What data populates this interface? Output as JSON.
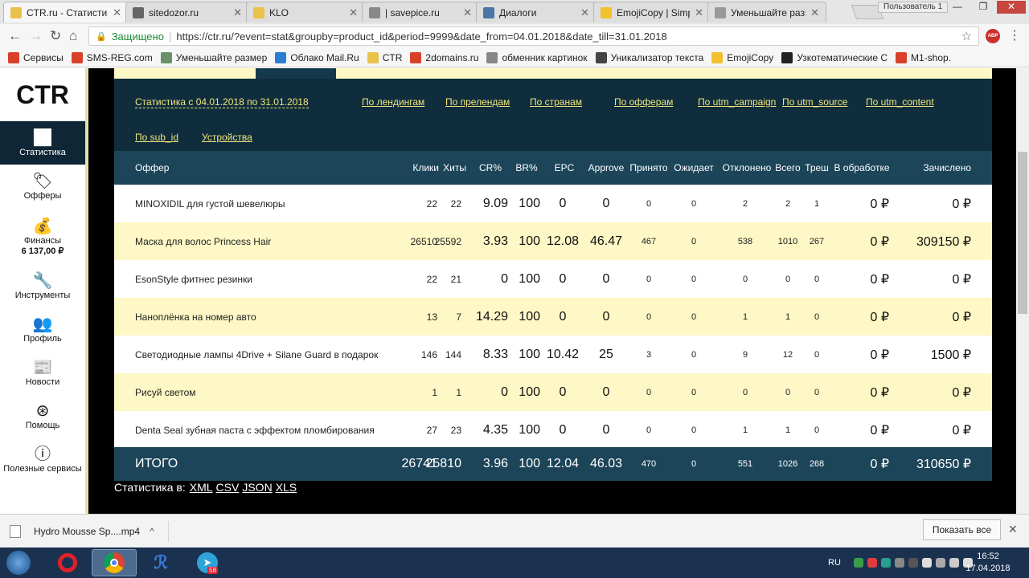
{
  "browser": {
    "tabs": [
      {
        "title": "CTR.ru - Статистика",
        "active": true,
        "icon": "folder-icon",
        "color": "#e8c24a"
      },
      {
        "title": "sitedozor.ru",
        "icon": "globe-icon",
        "color": "#666666"
      },
      {
        "title": "KLO",
        "icon": "mail-icon",
        "color": "#e8c24a"
      },
      {
        "title": "| savepice.ru",
        "icon": "page-icon",
        "color": "#888888"
      },
      {
        "title": "Диалоги",
        "icon": "vk-icon",
        "color": "#4a76a8"
      },
      {
        "title": "EmojiCopy | Simple",
        "icon": "emoji-icon",
        "color": "#f2c12e"
      },
      {
        "title": "Уменьшайте разме",
        "icon": "loading-icon",
        "color": "#999999"
      }
    ],
    "user": "Пользователь 1",
    "secure_label": "Защищено",
    "url": "https://ctr.ru/?event=stat&groupby=product_id&period=9999&date_from=04.01.2018&date_till=31.01.2018",
    "abp": "ABP",
    "bookmarks": [
      {
        "label": "Сервисы",
        "icon": "apps-icon",
        "color": "#d9402b"
      },
      {
        "label": "SMS-REG.com",
        "icon": "sms-icon",
        "color": "#d9402b"
      },
      {
        "label": "Уменьшайте размер",
        "icon": "compress-icon",
        "color": "#6a8f6a"
      },
      {
        "label": "Облако Mail.Ru",
        "icon": "cloud-icon",
        "color": "#2a7fd4"
      },
      {
        "label": "CTR",
        "icon": "folder-icon",
        "color": "#e8c24a"
      },
      {
        "label": "2domains.ru",
        "icon": "domains-icon",
        "color": "#d9402b"
      },
      {
        "label": "обменник картинок",
        "icon": "page-icon",
        "color": "#888888"
      },
      {
        "label": "Уникализатор текста",
        "icon": "copyright-icon",
        "color": "#444444"
      },
      {
        "label": "EmojiCopy",
        "icon": "emoji-icon",
        "color": "#f2c12e"
      },
      {
        "label": "Узкотематические С",
        "icon": "seo-icon",
        "color": "#222222"
      },
      {
        "label": "M1-shop.",
        "icon": "m1-icon",
        "color": "#d9402b"
      }
    ]
  },
  "sidebar": {
    "logo": "CTR",
    "items": [
      {
        "label": "Статистика",
        "icon": "chart-icon",
        "active": true
      },
      {
        "label": "Офферы",
        "icon": "tag-icon"
      },
      {
        "label": "Финансы",
        "icon": "money-bag-icon",
        "balance": "6 137,00 ₽"
      },
      {
        "label": "Инструменты",
        "icon": "wrench-icon"
      },
      {
        "label": "Профиль",
        "icon": "users-icon"
      },
      {
        "label": "Новости",
        "icon": "news-icon",
        "badge": "NEWS"
      },
      {
        "label": "Помощь",
        "icon": "help-icon"
      },
      {
        "label": "Полезные сервисы",
        "icon": "info-icon"
      }
    ]
  },
  "stats_nav": {
    "period_link": "Статистика с 04.01.2018 по 31.01.2018",
    "links": [
      "По лендингам",
      "По прелендам",
      "По странам",
      "По офферам",
      "По utm_campaign",
      "По utm_source",
      "По utm_content",
      "По sub_id",
      "Устройства"
    ]
  },
  "table": {
    "headers": [
      "Оффер",
      "Клики",
      "Хиты",
      "CR%",
      "BR%",
      "EPC",
      "Approve",
      "Принято",
      "Ожидает",
      "Отклонено",
      "Всего",
      "Треш",
      "В обработке",
      "Зачислено"
    ],
    "rows": [
      {
        "offer": "MINOXIDIL для густой шевелюры",
        "clicks": "22",
        "hits": "22",
        "cr": "9.09",
        "br": "100",
        "epc": "0",
        "approve": "0",
        "accepted": "0",
        "pending": "0",
        "rejected": "2",
        "total": "2",
        "trash": "1",
        "processing": "0 ₽",
        "credited": "0 ₽"
      },
      {
        "offer": "Маска для волос Princess Hair",
        "clicks": "26510",
        "hits": "25592",
        "cr": "3.93",
        "br": "100",
        "epc": "12.08",
        "approve": "46.47",
        "accepted": "467",
        "pending": "0",
        "rejected": "538",
        "total": "1010",
        "trash": "267",
        "processing": "0 ₽",
        "credited": "309150 ₽"
      },
      {
        "offer": "EsonStyle фитнес резинки",
        "clicks": "22",
        "hits": "21",
        "cr": "0",
        "br": "100",
        "epc": "0",
        "approve": "0",
        "accepted": "0",
        "pending": "0",
        "rejected": "0",
        "total": "0",
        "trash": "0",
        "processing": "0 ₽",
        "credited": "0 ₽"
      },
      {
        "offer": "Наноплёнка на номер авто",
        "clicks": "13",
        "hits": "7",
        "cr": "14.29",
        "br": "100",
        "epc": "0",
        "approve": "0",
        "accepted": "0",
        "pending": "0",
        "rejected": "1",
        "total": "1",
        "trash": "0",
        "processing": "0 ₽",
        "credited": "0 ₽"
      },
      {
        "offer": "Светодиодные лампы 4Drive + Silane Guard в подарок",
        "clicks": "146",
        "hits": "144",
        "cr": "8.33",
        "br": "100",
        "epc": "10.42",
        "approve": "25",
        "accepted": "3",
        "pending": "0",
        "rejected": "9",
        "total": "12",
        "trash": "0",
        "processing": "0 ₽",
        "credited": "1500 ₽"
      },
      {
        "offer": "Рисуй светом",
        "clicks": "1",
        "hits": "1",
        "cr": "0",
        "br": "100",
        "epc": "0",
        "approve": "0",
        "accepted": "0",
        "pending": "0",
        "rejected": "0",
        "total": "0",
        "trash": "0",
        "processing": "0 ₽",
        "credited": "0 ₽"
      },
      {
        "offer": "Denta Seal зубная паста с эффектом пломбирования",
        "clicks": "27",
        "hits": "23",
        "cr": "4.35",
        "br": "100",
        "epc": "0",
        "approve": "0",
        "accepted": "0",
        "pending": "0",
        "rejected": "1",
        "total": "1",
        "trash": "0",
        "processing": "0 ₽",
        "credited": "0 ₽"
      }
    ],
    "totals": {
      "offer": "ИТОГО",
      "clicks": "26741",
      "hits": "25810",
      "cr": "3.96",
      "br": "100",
      "epc": "12.04",
      "approve": "46.03",
      "accepted": "470",
      "pending": "0",
      "rejected": "551",
      "total": "1026",
      "trash": "268",
      "processing": "0 ₽",
      "credited": "310650 ₽"
    }
  },
  "export": {
    "label": "Статистика в:",
    "formats": [
      "XML",
      "CSV",
      "JSON",
      "XLS"
    ]
  },
  "download": {
    "filename": "Hydro Mousse Sp....mp4",
    "show_all": "Показать все"
  },
  "taskbar": {
    "apps": [
      "start-icon",
      "opera-icon",
      "chrome-icon",
      "app-icon",
      "telegram-icon"
    ],
    "telegram_badge": "58",
    "lang": "RU",
    "time": "16:52",
    "date": "17.04.2018"
  }
}
